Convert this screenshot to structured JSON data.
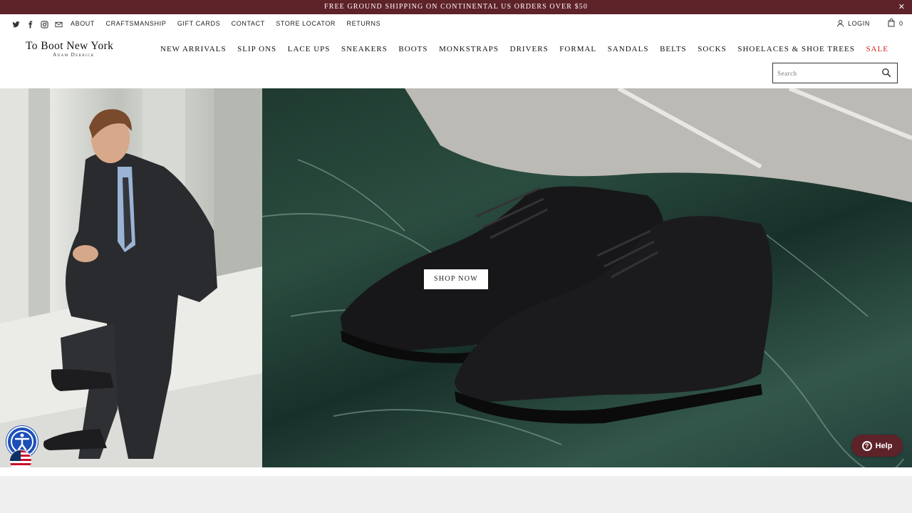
{
  "announcement": {
    "text": "FREE GROUND SHIPPING ON CONTINENTAL US ORDERS OVER $50",
    "close": "✕"
  },
  "social_icons": [
    "twitter-icon",
    "facebook-icon",
    "instagram-icon",
    "email-icon"
  ],
  "utility_links": [
    "ABOUT",
    "CRAFTSMANSHIP",
    "GIFT CARDS",
    "CONTACT",
    "STORE LOCATOR",
    "RETURNS"
  ],
  "account": {
    "login": "LOGIN",
    "cart_count": "0"
  },
  "logo": {
    "main": "To Boot New York",
    "sub": "Adam Derrick"
  },
  "nav": [
    "NEW ARRIVALS",
    "SLIP ONS",
    "LACE UPS",
    "SNEAKERS",
    "BOOTS",
    "MONKSTRAPS",
    "DRIVERS",
    "FORMAL",
    "SANDALS",
    "BELTS",
    "SOCKS",
    "SHOELACES & SHOE TREES",
    "SALE"
  ],
  "search": {
    "placeholder": "Search"
  },
  "hero": {
    "cta": "SHOP NOW"
  },
  "help": {
    "label": "Help"
  },
  "colors": {
    "announce_bg": "#5e2229",
    "sale": "#d0211c",
    "a11y": "#1c4fb8"
  }
}
